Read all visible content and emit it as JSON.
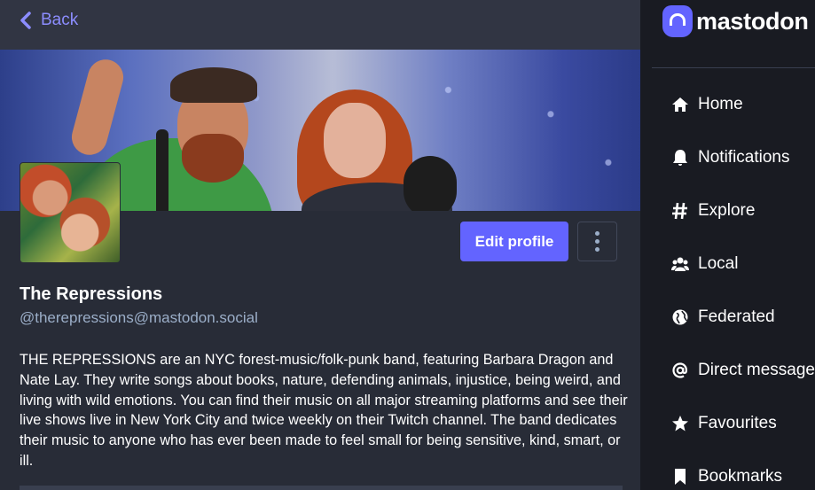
{
  "header": {
    "back_label": "Back"
  },
  "profile": {
    "display_name": "The Repressions",
    "handle": "@therepressions@mastodon.social",
    "bio": "THE REPRESSIONS are an NYC forest-music/folk-punk band, featuring Barbara Dragon and Nate Lay. They write songs about books, nature, defending animals, injustice, being weird, and living with wild emotions. You can find their music on all major streaming platforms and see their live shows live in New York City and twice weekly on their Twitch channel. The band dedicates their music to anyone who has ever been made to feel small for being sensitive, kind, smart, or ill.",
    "edit_label": "Edit profile"
  },
  "sidebar": {
    "brand": "mastodon",
    "items": [
      {
        "label": "Home",
        "icon": "home-icon"
      },
      {
        "label": "Notifications",
        "icon": "bell-icon"
      },
      {
        "label": "Explore",
        "icon": "hashtag-icon"
      },
      {
        "label": "Local",
        "icon": "users-icon"
      },
      {
        "label": "Federated",
        "icon": "globe-icon"
      },
      {
        "label": "Direct messages",
        "icon": "at-icon"
      },
      {
        "label": "Favourites",
        "icon": "star-icon"
      },
      {
        "label": "Bookmarks",
        "icon": "bookmark-icon"
      }
    ]
  },
  "colors": {
    "accent": "#6364ff",
    "link": "#8c8dff",
    "muted": "#9baec8",
    "bg_main": "#282c37",
    "bg_sidebar": "#191b22"
  }
}
